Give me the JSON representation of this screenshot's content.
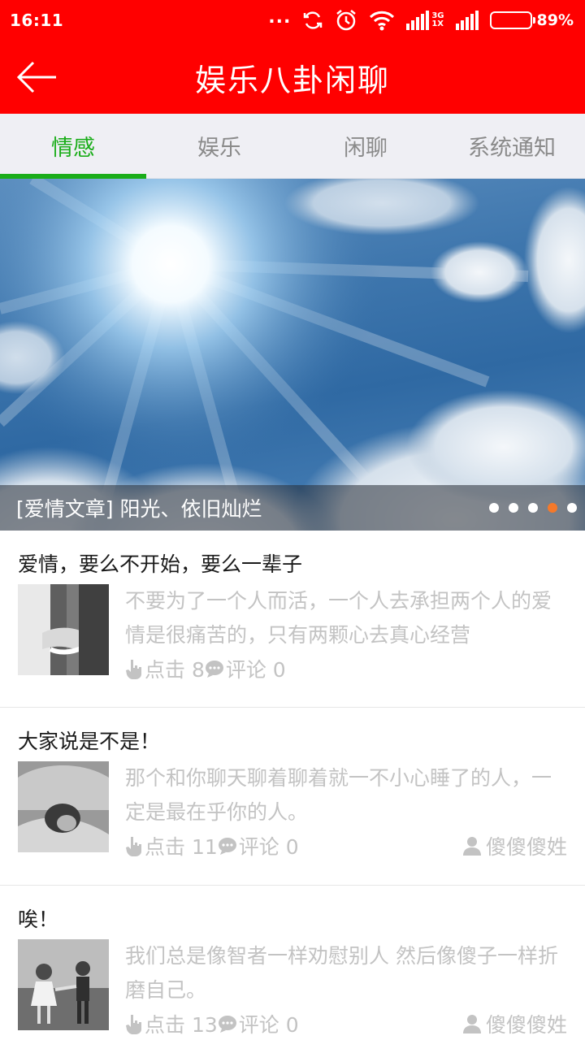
{
  "status_bar": {
    "time": "16:11",
    "dots": "...",
    "network_top": "3G",
    "network_bottom": "1X",
    "battery_percent": "89%",
    "battery_level": 0.89
  },
  "app_bar": {
    "title": "娱乐八卦闲聊"
  },
  "tabs": [
    {
      "label": "情感",
      "active": true
    },
    {
      "label": "娱乐",
      "active": false
    },
    {
      "label": "闲聊",
      "active": false
    },
    {
      "label": "系统通知",
      "active": false
    }
  ],
  "banner": {
    "caption": "[爱情文章] 阳光、依旧灿烂",
    "page_count": 5,
    "active_page": 4
  },
  "colors": {
    "brand_red": "#ff0000",
    "tab_active": "#1aad19",
    "pager_active": "#f5792a",
    "meta_gray": "#c3c3c3"
  },
  "articles": [
    {
      "title": "爱情，要么不开始，要么一辈子",
      "summary": "不要为了一个人而活，一个人去承担两个人的爱情是很痛苦的，只有两颗心去真心经营",
      "clicks_label": "点击 8",
      "comments_label": "评论 0",
      "author": "",
      "thumb_icon": "holding-hands-photo"
    },
    {
      "title": "大家说是不是！",
      "summary": "那个和你聊天聊着聊着就一不小心睡了的人，一定是最在乎你的人。",
      "clicks_label": "点击 11",
      "comments_label": "评论 0",
      "author": "傻傻傻姓",
      "thumb_icon": "sleeping-girl-photo"
    },
    {
      "title": "唉！",
      "summary": "我们总是像智者一样劝慰别人 然后像傻子一样折磨自己。",
      "clicks_label": "点击 13",
      "comments_label": "评论 0",
      "author": "傻傻傻姓",
      "thumb_icon": "two-children-photo"
    }
  ]
}
